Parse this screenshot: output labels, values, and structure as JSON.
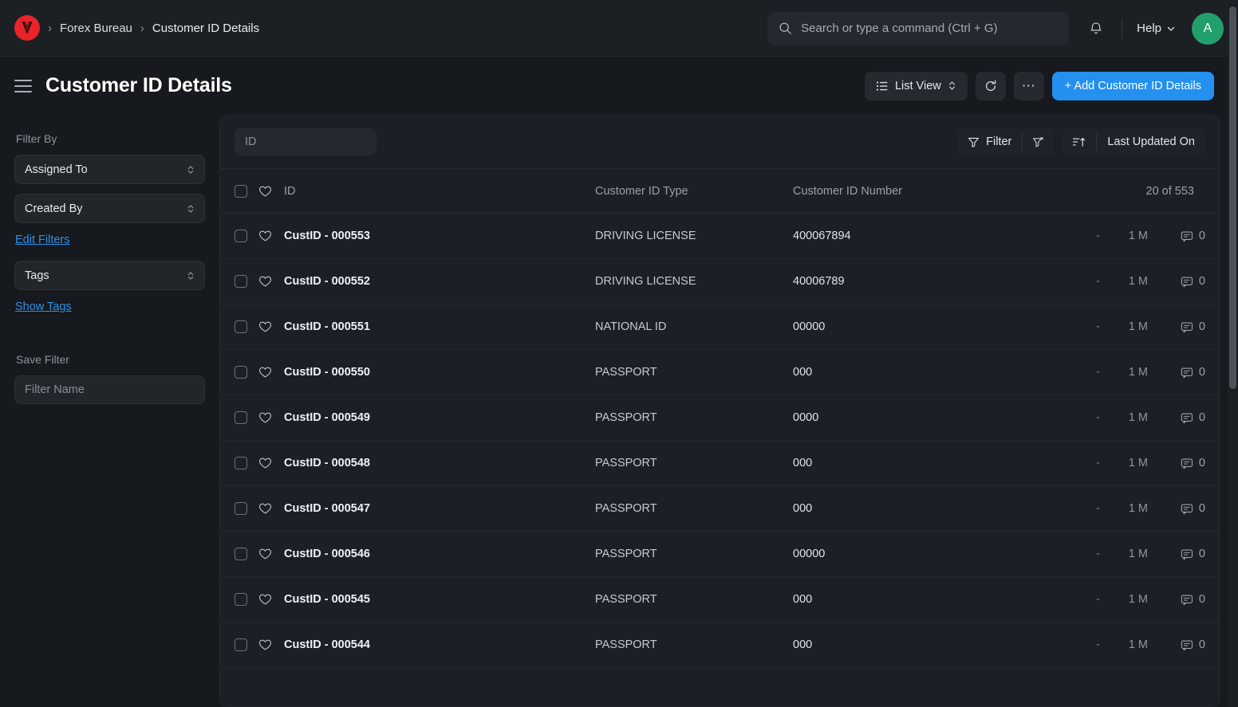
{
  "navbar": {
    "logo_icon": "brand-logo-icon",
    "breadcrumbs": [
      {
        "label": "Forex Bureau"
      },
      {
        "label": "Customer ID Details"
      }
    ],
    "separator": "›",
    "search": {
      "placeholder": "Search or type a command (Ctrl + G)",
      "value": "",
      "icon": "search-icon"
    },
    "notifications_icon": "bell-icon",
    "help_label": "Help",
    "help_chevron_icon": "chevron-down-icon",
    "avatar_initial": "A",
    "avatar_color": "#22a06b"
  },
  "page": {
    "menu_icon": "hamburger-menu-icon",
    "title": "Customer ID Details",
    "actions": {
      "view_switch_label": "List View",
      "view_switch_icon": "list-icon",
      "view_switch_chevron": "chevron-updown-icon",
      "refresh_icon": "refresh-icon",
      "more_label": "⋯",
      "add_label": "+ Add Customer ID Details",
      "add_color": "#2490ef"
    }
  },
  "sidebar": {
    "filter_by_label": "Filter By",
    "assigned_to_label": "Assigned To",
    "created_by_label": "Created By",
    "edit_filters_label": "Edit Filters",
    "tags_label": "Tags",
    "show_tags_label": "Show Tags",
    "save_filter_label": "Save Filter",
    "filter_name_placeholder": "Filter Name",
    "link_color": "#2e8fea"
  },
  "toolbar": {
    "id_filter_placeholder": "ID",
    "filter_label": "Filter",
    "filter_icon": "funnel-icon",
    "clear_filter_icon": "funnel-clear-icon",
    "sort_icon": "sort-ascending-icon",
    "sort_label": "Last Updated On"
  },
  "table": {
    "columns": {
      "id": "ID",
      "customer_id_type": "Customer ID Type",
      "customer_id_number": "Customer ID Number"
    },
    "count_label": "20 of 553",
    "select_all_icon": "checkbox-icon",
    "like_icon": "heart-icon",
    "comment_icon": "comment-icon",
    "rows": [
      {
        "id": "CustID - 000553",
        "type": "DRIVING LICENSE",
        "number": "400067894",
        "assigned": "-",
        "modified": "1 M",
        "comments": "0"
      },
      {
        "id": "CustID - 000552",
        "type": "DRIVING LICENSE",
        "number": "40006789",
        "assigned": "-",
        "modified": "1 M",
        "comments": "0"
      },
      {
        "id": "CustID - 000551",
        "type": "NATIONAL ID",
        "number": "00000",
        "assigned": "-",
        "modified": "1 M",
        "comments": "0"
      },
      {
        "id": "CustID - 000550",
        "type": "PASSPORT",
        "number": "000",
        "assigned": "-",
        "modified": "1 M",
        "comments": "0"
      },
      {
        "id": "CustID - 000549",
        "type": "PASSPORT",
        "number": "0000",
        "assigned": "-",
        "modified": "1 M",
        "comments": "0"
      },
      {
        "id": "CustID - 000548",
        "type": "PASSPORT",
        "number": "000",
        "assigned": "-",
        "modified": "1 M",
        "comments": "0"
      },
      {
        "id": "CustID - 000547",
        "type": "PASSPORT",
        "number": "000",
        "assigned": "-",
        "modified": "1 M",
        "comments": "0"
      },
      {
        "id": "CustID - 000546",
        "type": "PASSPORT",
        "number": "00000",
        "assigned": "-",
        "modified": "1 M",
        "comments": "0"
      },
      {
        "id": "CustID - 000545",
        "type": "PASSPORT",
        "number": "000",
        "assigned": "-",
        "modified": "1 M",
        "comments": "0"
      },
      {
        "id": "CustID - 000544",
        "type": "PASSPORT",
        "number": "000",
        "assigned": "-",
        "modified": "1 M",
        "comments": "0"
      }
    ]
  }
}
